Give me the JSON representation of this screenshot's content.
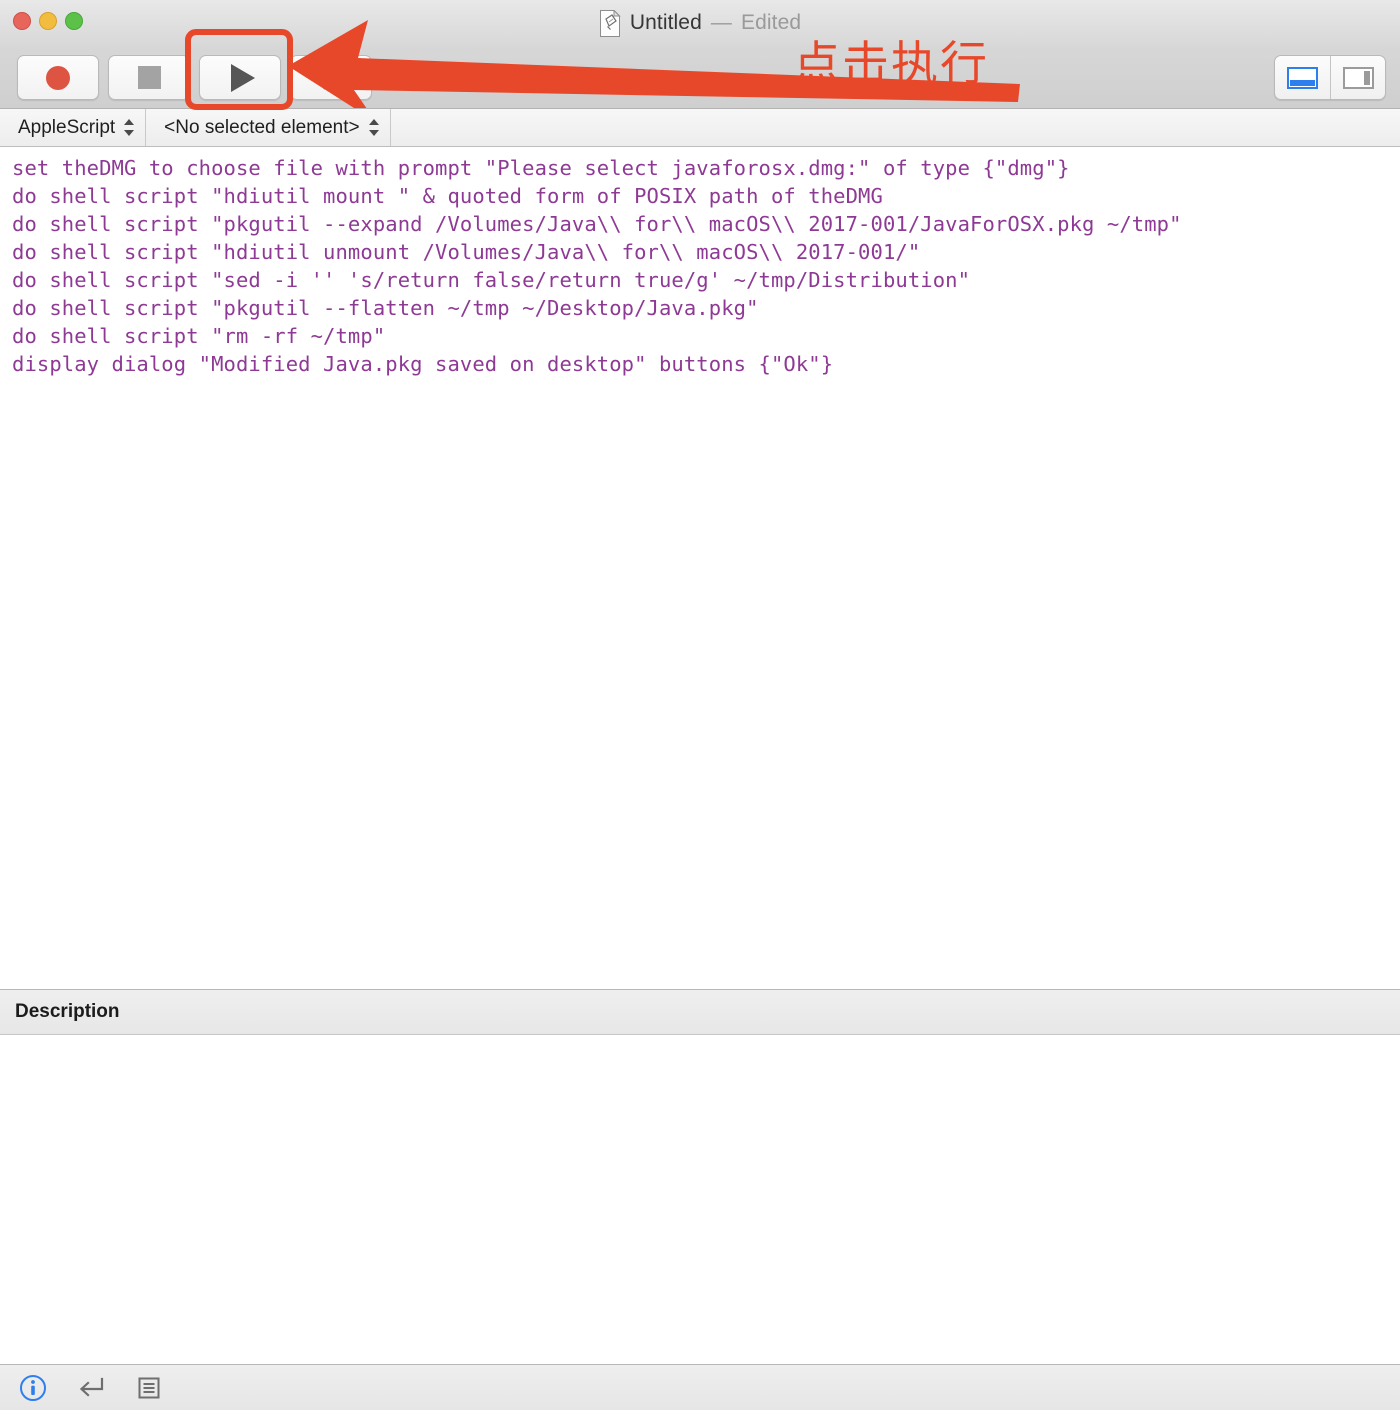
{
  "window": {
    "title_name": "Untitled",
    "title_separator": "—",
    "title_state": "Edited",
    "doc_icon": "applescript-document-icon",
    "traffic_lights": {
      "close_label": "close",
      "minimize_label": "minimize",
      "maximize_label": "maximize",
      "close_color": "#e8655c",
      "minimize_color": "#f2bc3f",
      "maximize_color": "#5cc148"
    }
  },
  "toolbar": {
    "buttons": [
      {
        "name": "record-button",
        "icon": "record-circle-icon",
        "label": "Record"
      },
      {
        "name": "stop-button",
        "icon": "stop-square-icon",
        "label": "Stop"
      },
      {
        "name": "run-button",
        "icon": "play-triangle-icon",
        "label": "Run"
      },
      {
        "name": "compile-button",
        "icon": "hammer-icon",
        "label": "Compile"
      }
    ],
    "view_modes": [
      {
        "name": "bottom-panel-view-button",
        "icon": "bottom-panel-icon",
        "label": "Show bottom panel",
        "active": true,
        "color": "#2e7fee"
      },
      {
        "name": "right-panel-view-button",
        "icon": "right-panel-icon",
        "label": "Show right panel",
        "active": false,
        "color": "#9b9b9b"
      }
    ]
  },
  "selector_bar": {
    "language_popup": {
      "value": "AppleScript",
      "icon": "chevron-updown-icon"
    },
    "element_popup": {
      "value": "<No selected element>",
      "icon": "chevron-updown-icon"
    }
  },
  "editor": {
    "text_color": "#8e3a95",
    "lines": [
      "set theDMG to choose file with prompt \"Please select javaforosx.dmg:\" of type {\"dmg\"}",
      "do shell script \"hdiutil mount \" & quoted form of POSIX path of theDMG",
      "do shell script \"pkgutil --expand /Volumes/Java\\\\ for\\\\ macOS\\\\ 2017-001/JavaForOSX.pkg ~/tmp\"",
      "do shell script \"hdiutil unmount /Volumes/Java\\\\ for\\\\ macOS\\\\ 2017-001/\"",
      "do shell script \"sed -i '' 's/return false/return true/g' ~/tmp/Distribution\"",
      "do shell script \"pkgutil --flatten ~/tmp ~/Desktop/Java.pkg\"",
      "do shell script \"rm -rf ~/tmp\"",
      "display dialog \"Modified Java.pkg saved on desktop\" buttons {\"Ok\"}"
    ]
  },
  "description_pane": {
    "header_title": "Description",
    "body_text": ""
  },
  "footer": {
    "icons": [
      {
        "name": "info-icon",
        "label": "Description",
        "color": "#2e7fee"
      },
      {
        "name": "return-arrow-icon",
        "label": "Result",
        "color": "#6e6e6e"
      },
      {
        "name": "list-lines-icon",
        "label": "Event Log",
        "color": "#6e6e6e"
      }
    ]
  },
  "annotations": {
    "callout_text": "点击执行",
    "callout_color": "#e8482a",
    "highlight_target": "run-button",
    "arrow_direction": "right-to-left"
  }
}
